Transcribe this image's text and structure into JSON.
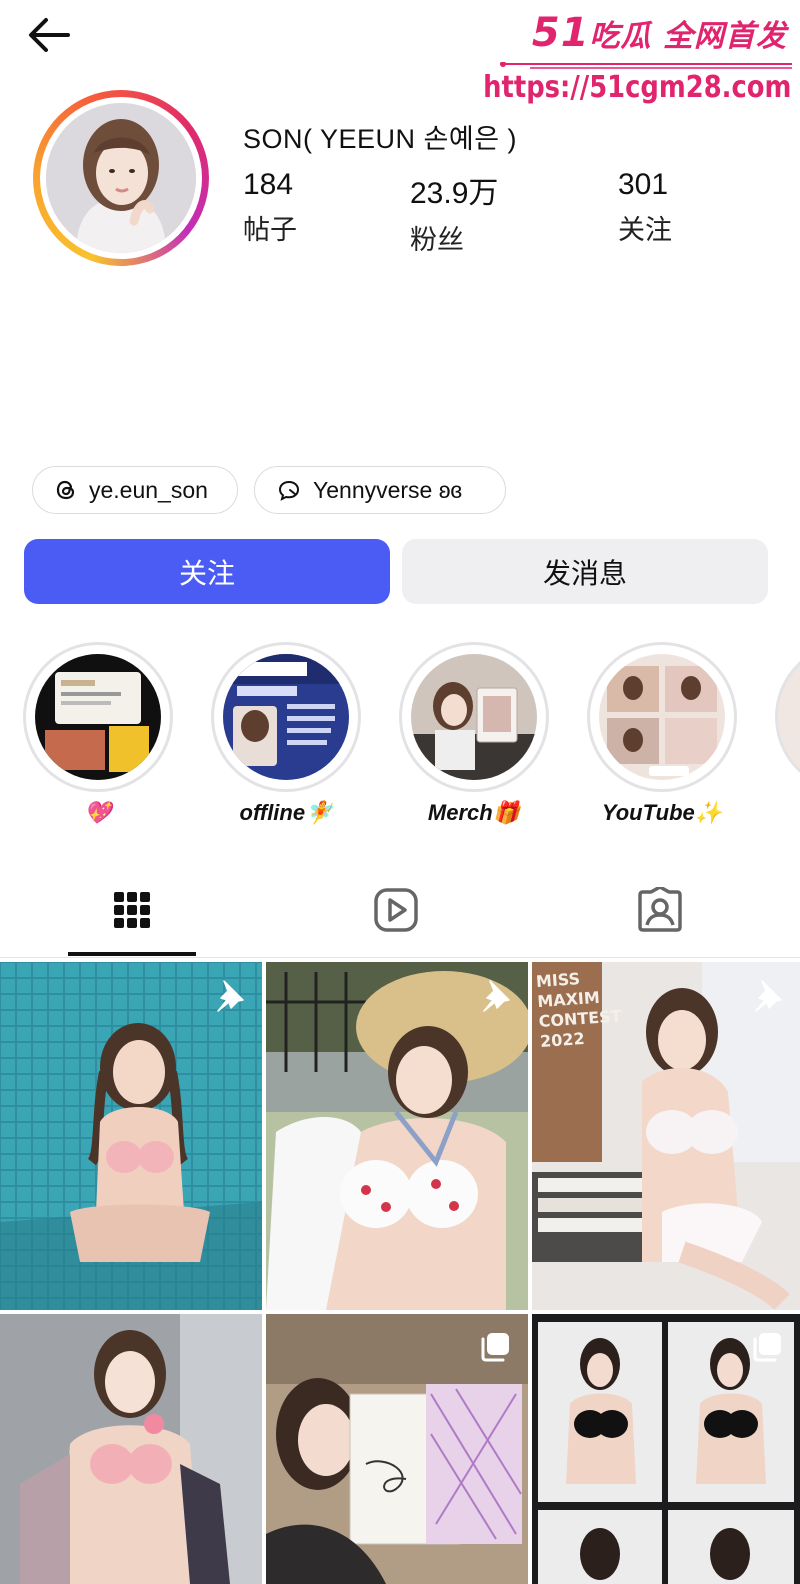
{
  "header": {
    "back_icon": "arrow-left-icon",
    "watermark": {
      "brand_number": "51",
      "brand_text": "吃瓜 全网首发",
      "url": "https://51cgm28.com",
      "color": "#e0246e"
    }
  },
  "profile": {
    "name": "SON( YEEUN 손예은 )",
    "ring_colors": [
      "#f9c22e",
      "#f55a3c",
      "#e02a6c",
      "#c22eb8"
    ],
    "stats": [
      {
        "value": "184",
        "label": "帖子"
      },
      {
        "value": "23.9万",
        "label": "粉丝"
      },
      {
        "value": "301",
        "label": "关注"
      }
    ]
  },
  "links": [
    {
      "icon": "threads-icon",
      "label": "ye.eun_son"
    },
    {
      "icon": "chat-bubble-icon",
      "label": "Yennyverse ʚ⁠ɞ"
    }
  ],
  "actions": {
    "follow_label": "关注",
    "message_label": "发消息",
    "follow_color": "#4b5cf5"
  },
  "highlights": [
    {
      "label": "💖"
    },
    {
      "label": "offline🧚"
    },
    {
      "label": "Merch🎁"
    },
    {
      "label": "YouTube✨"
    }
  ],
  "tabs": [
    {
      "icon": "grid-icon",
      "active": true
    },
    {
      "icon": "reels-play-icon",
      "active": false
    },
    {
      "icon": "tagged-person-icon",
      "active": false
    }
  ],
  "posts": [
    {
      "pinned": true
    },
    {
      "pinned": true
    },
    {
      "pinned": true,
      "text": "MISS MAXIM CONTEST 2022"
    },
    {
      "pinned": false
    },
    {
      "pinned": false,
      "multi": true
    },
    {
      "pinned": false,
      "multi": true
    }
  ]
}
